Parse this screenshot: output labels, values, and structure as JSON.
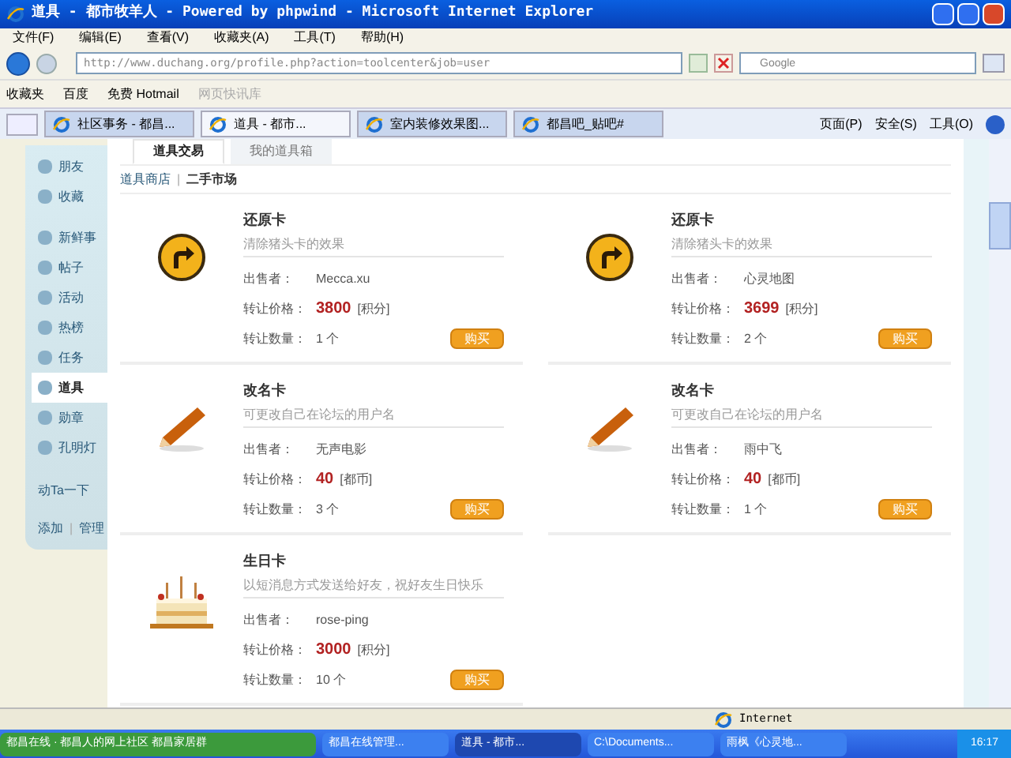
{
  "window": {
    "title": "道具 - 都市牧羊人 - Powered by phpwind - Microsoft Internet Explorer"
  },
  "menu": [
    "文件(F)",
    "编辑(E)",
    "查看(V)",
    "收藏夹(A)",
    "工具(T)",
    "帮助(H)"
  ],
  "address": {
    "value": "http://www.duchang.org/profile.php?action=toolcenter&job=user"
  },
  "search": {
    "placeholder": "Google"
  },
  "favorites_bar": [
    {
      "label": "收藏夹",
      "disabled": false
    },
    {
      "label": "百度",
      "disabled": false
    },
    {
      "label": "免费 Hotmail",
      "disabled": false
    },
    {
      "label": "网页快讯库",
      "disabled": true
    }
  ],
  "browser_tabs": [
    {
      "label": "社区事务 - 都昌...",
      "selected": false
    },
    {
      "label": "道具 - 都市...",
      "selected": true
    },
    {
      "label": "室内装修效果图...",
      "selected": false
    },
    {
      "label": "都昌吧_贴吧#",
      "selected": false
    }
  ],
  "command_bar": [
    "页面(P)",
    "安全(S)",
    "工具(O)"
  ],
  "sidebar": {
    "items": [
      {
        "label": "朋友",
        "selected": false
      },
      {
        "label": "收藏",
        "selected": false
      },
      {
        "label": "新鲜事",
        "selected": false
      },
      {
        "label": "帖子",
        "selected": false
      },
      {
        "label": "活动",
        "selected": false
      },
      {
        "label": "热榜",
        "selected": false
      },
      {
        "label": "任务",
        "selected": false
      },
      {
        "label": "道具",
        "selected": true
      },
      {
        "label": "勋章",
        "selected": false
      },
      {
        "label": "孔明灯",
        "selected": false
      }
    ],
    "poke": "动Ta一下",
    "links": [
      "添加",
      "|",
      "管理"
    ]
  },
  "page_tabs": [
    {
      "label": "道具交易",
      "selected": true
    },
    {
      "label": "我的道具箱",
      "selected": false
    }
  ],
  "breadcrumb": [
    "道具商店",
    "|",
    "二手市场"
  ],
  "items": [
    {
      "kind": "restore",
      "name": "还原卡",
      "desc": "清除猪头卡的效果",
      "seller_label": "出售者：",
      "seller": "Mecca.xu",
      "price_label": "转让价格：",
      "price": "3800",
      "unit": "[积分]",
      "qty_label": "转让数量：",
      "qty": "1 个",
      "button": "购买"
    },
    {
      "kind": "restore",
      "name": "还原卡",
      "desc": "清除猪头卡的效果",
      "seller_label": "出售者：",
      "seller": "心灵地图",
      "price_label": "转让价格：",
      "price": "3699",
      "unit": "[积分]",
      "qty_label": "转让数量：",
      "qty": "2 个",
      "button": "购买"
    },
    {
      "kind": "rename",
      "name": "改名卡",
      "desc": "可更改自己在论坛的用户名",
      "seller_label": "出售者：",
      "seller": "无声电影",
      "price_label": "转让价格：",
      "price": "40",
      "unit": "[都币]",
      "qty_label": "转让数量：",
      "qty": "3 个",
      "button": "购买"
    },
    {
      "kind": "rename",
      "name": "改名卡",
      "desc": "可更改自己在论坛的用户名",
      "seller_label": "出售者：",
      "seller": "雨中飞",
      "price_label": "转让价格：",
      "price": "40",
      "unit": "[都币]",
      "qty_label": "转让数量：",
      "qty": "1 个",
      "button": "购买"
    },
    {
      "kind": "birthday",
      "name": "生日卡",
      "desc": "以短消息方式发送给好友，祝好友生日快乐",
      "seller_label": "出售者：",
      "seller": "rose-ping",
      "price_label": "转让价格：",
      "price": "3000",
      "unit": "[积分]",
      "qty_label": "转让数量：",
      "qty": "10 个",
      "button": "购买"
    }
  ],
  "status_bar": {
    "zone": "Internet"
  },
  "taskbar": {
    "items": [
      {
        "label": "都昌在线 · 都昌人的网上社区 都昌家居群",
        "selected": false
      },
      {
        "label": "都昌在线管理...",
        "selected": false
      },
      {
        "label": "道具 - 都市...",
        "selected": true
      },
      {
        "label": "C:\\Documents...",
        "selected": false
      },
      {
        "label": "雨枫《心灵地...",
        "selected": false
      }
    ],
    "time": "16:17"
  }
}
